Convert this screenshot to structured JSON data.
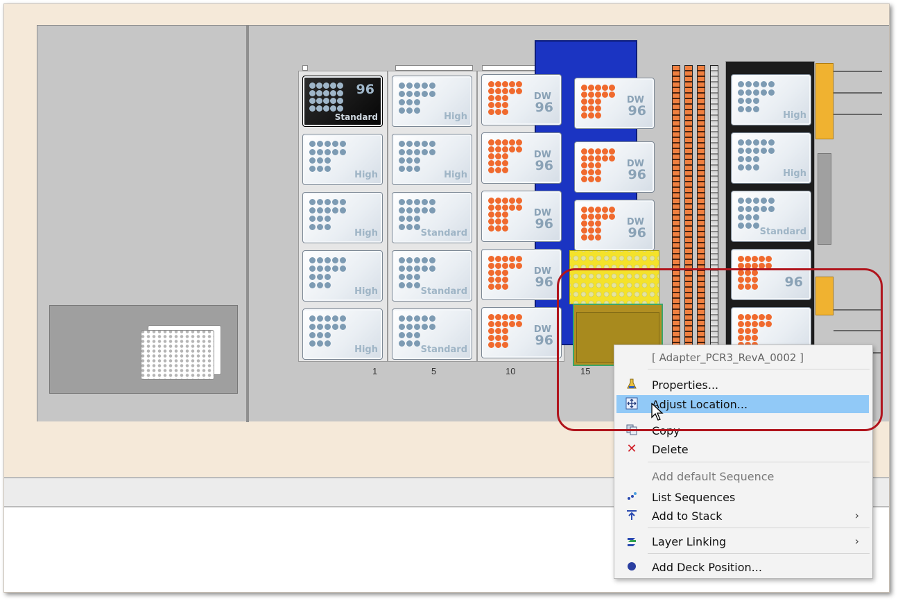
{
  "deck": {
    "carriers": [
      {
        "slot": "1",
        "labware": [
          {
            "label": "Standard",
            "type": "96",
            "style": "dark"
          },
          {
            "label": "High"
          },
          {
            "label": "High"
          },
          {
            "label": "High"
          },
          {
            "label": "High"
          }
        ]
      },
      {
        "slot": "5",
        "labware": [
          {
            "label": "High"
          },
          {
            "label": "High"
          },
          {
            "label": "Standard"
          },
          {
            "label": "Standard"
          },
          {
            "label": "Standard"
          }
        ]
      },
      {
        "slot": "10",
        "labware": [
          {
            "dw": "DW",
            "type": "96"
          },
          {
            "dw": "DW",
            "type": "96"
          },
          {
            "dw": "DW",
            "type": "96"
          },
          {
            "dw": "DW",
            "type": "96"
          },
          {
            "dw": "DW",
            "type": "96"
          }
        ]
      },
      {
        "slot": "15",
        "labware": [
          {
            "dw": "DW",
            "type": "96"
          },
          {
            "dw": "DW",
            "type": "96"
          },
          {
            "dw": "DW",
            "type": "96"
          }
        ]
      },
      {
        "slot": "",
        "labware": [
          {
            "label": "High"
          },
          {
            "label": "High"
          },
          {
            "label": "Standard"
          },
          {
            "type": "96"
          },
          {
            "type": ""
          }
        ]
      }
    ]
  },
  "context_menu": {
    "header": "[ Adapter_PCR3_RevA_0002 ]",
    "items": [
      {
        "label": "Properties...",
        "icon": "flask-icon"
      },
      {
        "label": "Adjust Location...",
        "icon": "move-icon",
        "selected": true
      },
      {
        "label": "Copy",
        "icon": "copy-icon"
      },
      {
        "label": "Delete",
        "icon": "delete-icon"
      },
      {
        "label": "Add default Sequence",
        "icon": "",
        "disabled": true
      },
      {
        "label": "List Sequences",
        "icon": "sequence-icon"
      },
      {
        "label": "Add to Stack",
        "icon": "stack-icon",
        "submenu": true
      },
      {
        "label": "Layer Linking",
        "icon": "layer-link-icon",
        "submenu": true
      },
      {
        "label": "Add Deck Position...",
        "icon": "deck-position-icon"
      }
    ]
  },
  "colors": {
    "highlight": "#b0141c",
    "menu_selected": "#91c9f7",
    "carrier_15": "#1b34c2",
    "dw_wells": "#f06a2e",
    "std_wells": "#7d9bb3"
  }
}
